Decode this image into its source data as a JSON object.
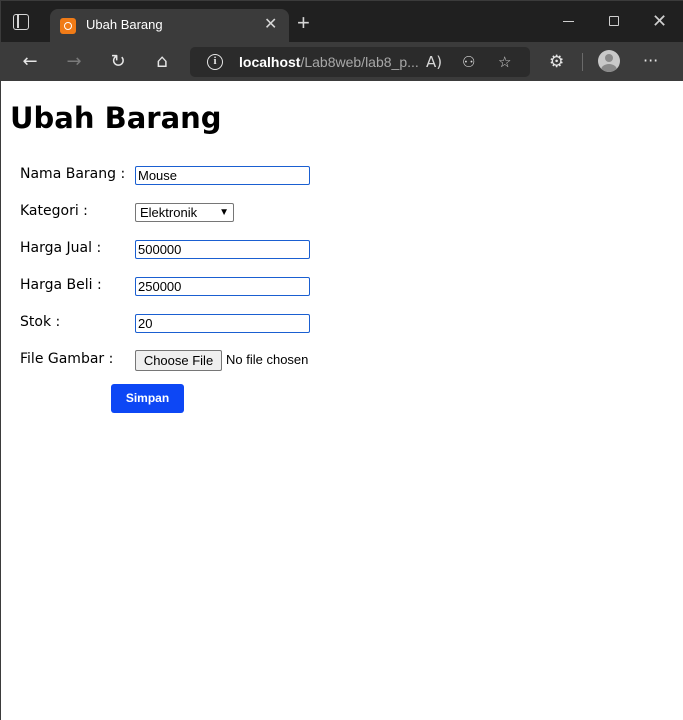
{
  "browser": {
    "tab_title": "Ubah Barang",
    "tab_close": "✕",
    "new_tab": "+",
    "url_host": "localhost",
    "url_path": "/Lab8web/lab8_p...",
    "icons": {
      "back": "back-arrow-icon",
      "forward": "forward-arrow-icon",
      "refresh": "refresh-icon",
      "home": "home-icon",
      "site_info": "info-icon",
      "read_aloud": "read-aloud-icon",
      "permissions": "permissions-icon",
      "favorites": "add-favorite-icon",
      "extensions": "extensions-icon",
      "profile": "profile-avatar-icon",
      "menu": "more-menu-icon"
    },
    "accent": "#f07b17"
  },
  "page": {
    "title": "Ubah Barang",
    "form": {
      "nama_label": "Nama Barang :",
      "nama_value": "Mouse",
      "kategori_label": "Kategori :",
      "kategori_value": "Elektronik",
      "harga_jual_label": "Harga Jual :",
      "harga_jual_value": "500000",
      "harga_beli_label": "Harga Beli :",
      "harga_beli_value": "250000",
      "stok_label": "Stok :",
      "stok_value": "20",
      "gambar_label": "File Gambar :",
      "file_button": "Choose File",
      "file_status": "No file chosen",
      "submit_label": "Simpan"
    },
    "submit_color": "#0d47f5",
    "input_border_color": "#1a5fd1"
  }
}
